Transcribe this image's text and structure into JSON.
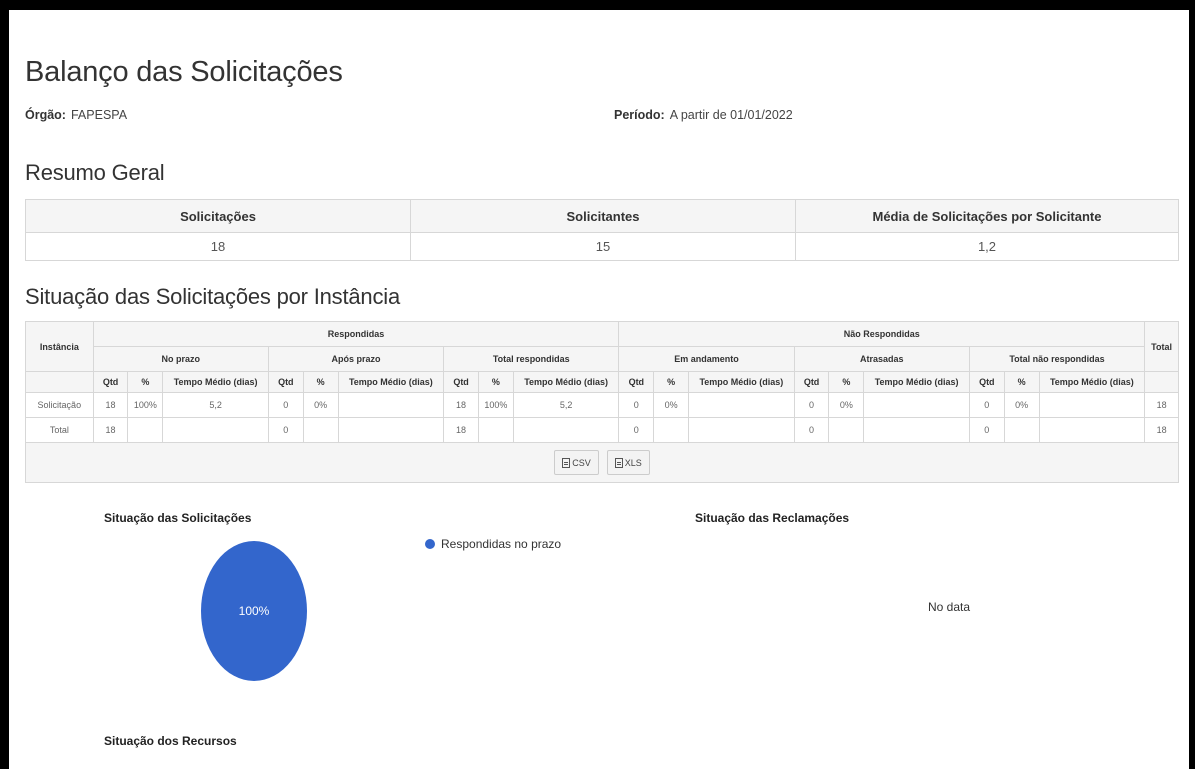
{
  "header": {
    "title": "Balanço das Solicitações",
    "orgao_label": "Órgão:",
    "orgao_value": "FAPESPA",
    "periodo_label": "Período:",
    "periodo_value": "A partir de 01/01/2022"
  },
  "resumo": {
    "title": "Resumo Geral",
    "columns": [
      "Solicitações",
      "Solicitantes",
      "Média de Solicitações por Solicitante"
    ],
    "values": [
      "18",
      "15",
      "1,2"
    ]
  },
  "instancia": {
    "title": "Situação das Solicitações por Instância",
    "h_instancia": "Instância",
    "h_respondidas": "Respondidas",
    "h_nao_respondidas": "Não Respondidas",
    "h_total": "Total",
    "groups": [
      "No prazo",
      "Após prazo",
      "Total respondidas",
      "Em andamento",
      "Atrasadas",
      "Total não respondidas"
    ],
    "sub": {
      "qtd": "Qtd",
      "pct": "%",
      "tempo": "Tempo Médio (dias)"
    },
    "rows": [
      {
        "name": "Solicitação",
        "cells": [
          "18",
          "100%",
          "5,2",
          "0",
          "0%",
          "",
          "18",
          "100%",
          "5,2",
          "0",
          "0%",
          "",
          "0",
          "0%",
          "",
          "0",
          "0%",
          ""
        ],
        "total": "18"
      },
      {
        "name": "Total",
        "cells": [
          "18",
          "",
          "",
          "0",
          "",
          "",
          "18",
          "",
          "",
          "0",
          "",
          "",
          "0",
          "",
          "",
          "0",
          "",
          ""
        ],
        "total": "18"
      }
    ],
    "buttons": {
      "csv": "CSV",
      "xls": "XLS"
    }
  },
  "charts": {
    "solicitacoes_title": "Situação das Solicitações",
    "reclamacoes_title": "Situação das Reclamações",
    "recursos_title": "Situação dos Recursos",
    "nodata_label": "No data",
    "legend_label": "Respondidas no prazo",
    "slice_label": "100%",
    "slice_color": "#3366cc"
  },
  "chart_data": {
    "type": "pie",
    "title": "Situação das Solicitações",
    "categories": [
      "Respondidas no prazo"
    ],
    "values": [
      100
    ],
    "legend_placement": "right"
  }
}
